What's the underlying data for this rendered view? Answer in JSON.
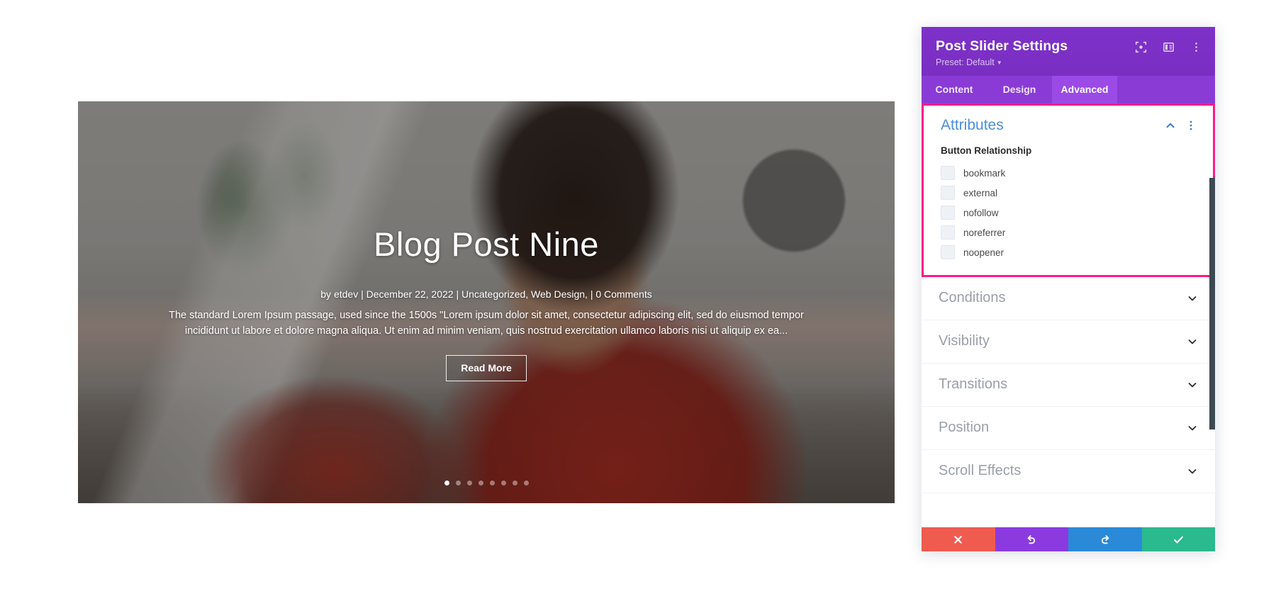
{
  "slider": {
    "title": "Blog Post Nine",
    "meta": "by etdev  |  December 22, 2022  |  Uncategorized, Web Design,  |  0 Comments",
    "excerpt": "The standard Lorem Ipsum passage, used since the 1500s \"Lorem ipsum dolor sit amet, consectetur adipiscing elit, sed do eiusmod tempor incididunt ut labore et dolore magna aliqua. Ut enim ad minim veniam, quis nostrud exercitation ullamco laboris nisi ut aliquip ex ea...",
    "read_more_label": "Read More",
    "dots": [
      {
        "active": true
      },
      {
        "active": false
      },
      {
        "active": false
      },
      {
        "active": false
      },
      {
        "active": false
      },
      {
        "active": false
      },
      {
        "active": false
      },
      {
        "active": false
      }
    ]
  },
  "panel": {
    "title": "Post Slider Settings",
    "preset_label": "Preset: Default",
    "header_icons": [
      {
        "name": "focus-target-icon"
      },
      {
        "name": "split-layout-icon"
      },
      {
        "name": "more-vertical-icon"
      }
    ],
    "tabs": [
      {
        "label": "Content",
        "active": false
      },
      {
        "label": "Design",
        "active": false
      },
      {
        "label": "Advanced",
        "active": true
      }
    ],
    "attributes": {
      "heading": "Attributes",
      "collapse_icon": "chevron-up-icon",
      "options_icon": "more-vertical-icon",
      "field_label": "Button Relationship",
      "checkboxes": [
        {
          "label": "bookmark",
          "checked": false
        },
        {
          "label": "external",
          "checked": false
        },
        {
          "label": "nofollow",
          "checked": false
        },
        {
          "label": "noreferrer",
          "checked": false
        },
        {
          "label": "noopener",
          "checked": false
        }
      ]
    },
    "sections": [
      {
        "label": "Conditions"
      },
      {
        "label": "Visibility"
      },
      {
        "label": "Transitions"
      },
      {
        "label": "Position"
      },
      {
        "label": "Scroll Effects"
      }
    ],
    "footer_buttons": [
      {
        "name": "cancel-button",
        "icon": "close-icon",
        "color": "#f05b50"
      },
      {
        "name": "undo-button",
        "icon": "undo-icon",
        "color": "#8b3ae0"
      },
      {
        "name": "redo-button",
        "icon": "redo-icon",
        "color": "#2a8ad8"
      },
      {
        "name": "save-button",
        "icon": "check-icon",
        "color": "#2bb98e"
      }
    ]
  },
  "colors": {
    "highlight_border": "#ff1a86",
    "panel_header": "#7a2ec2",
    "tab_active": "#9b4ae6",
    "section_heading": "#4c8fd6"
  }
}
